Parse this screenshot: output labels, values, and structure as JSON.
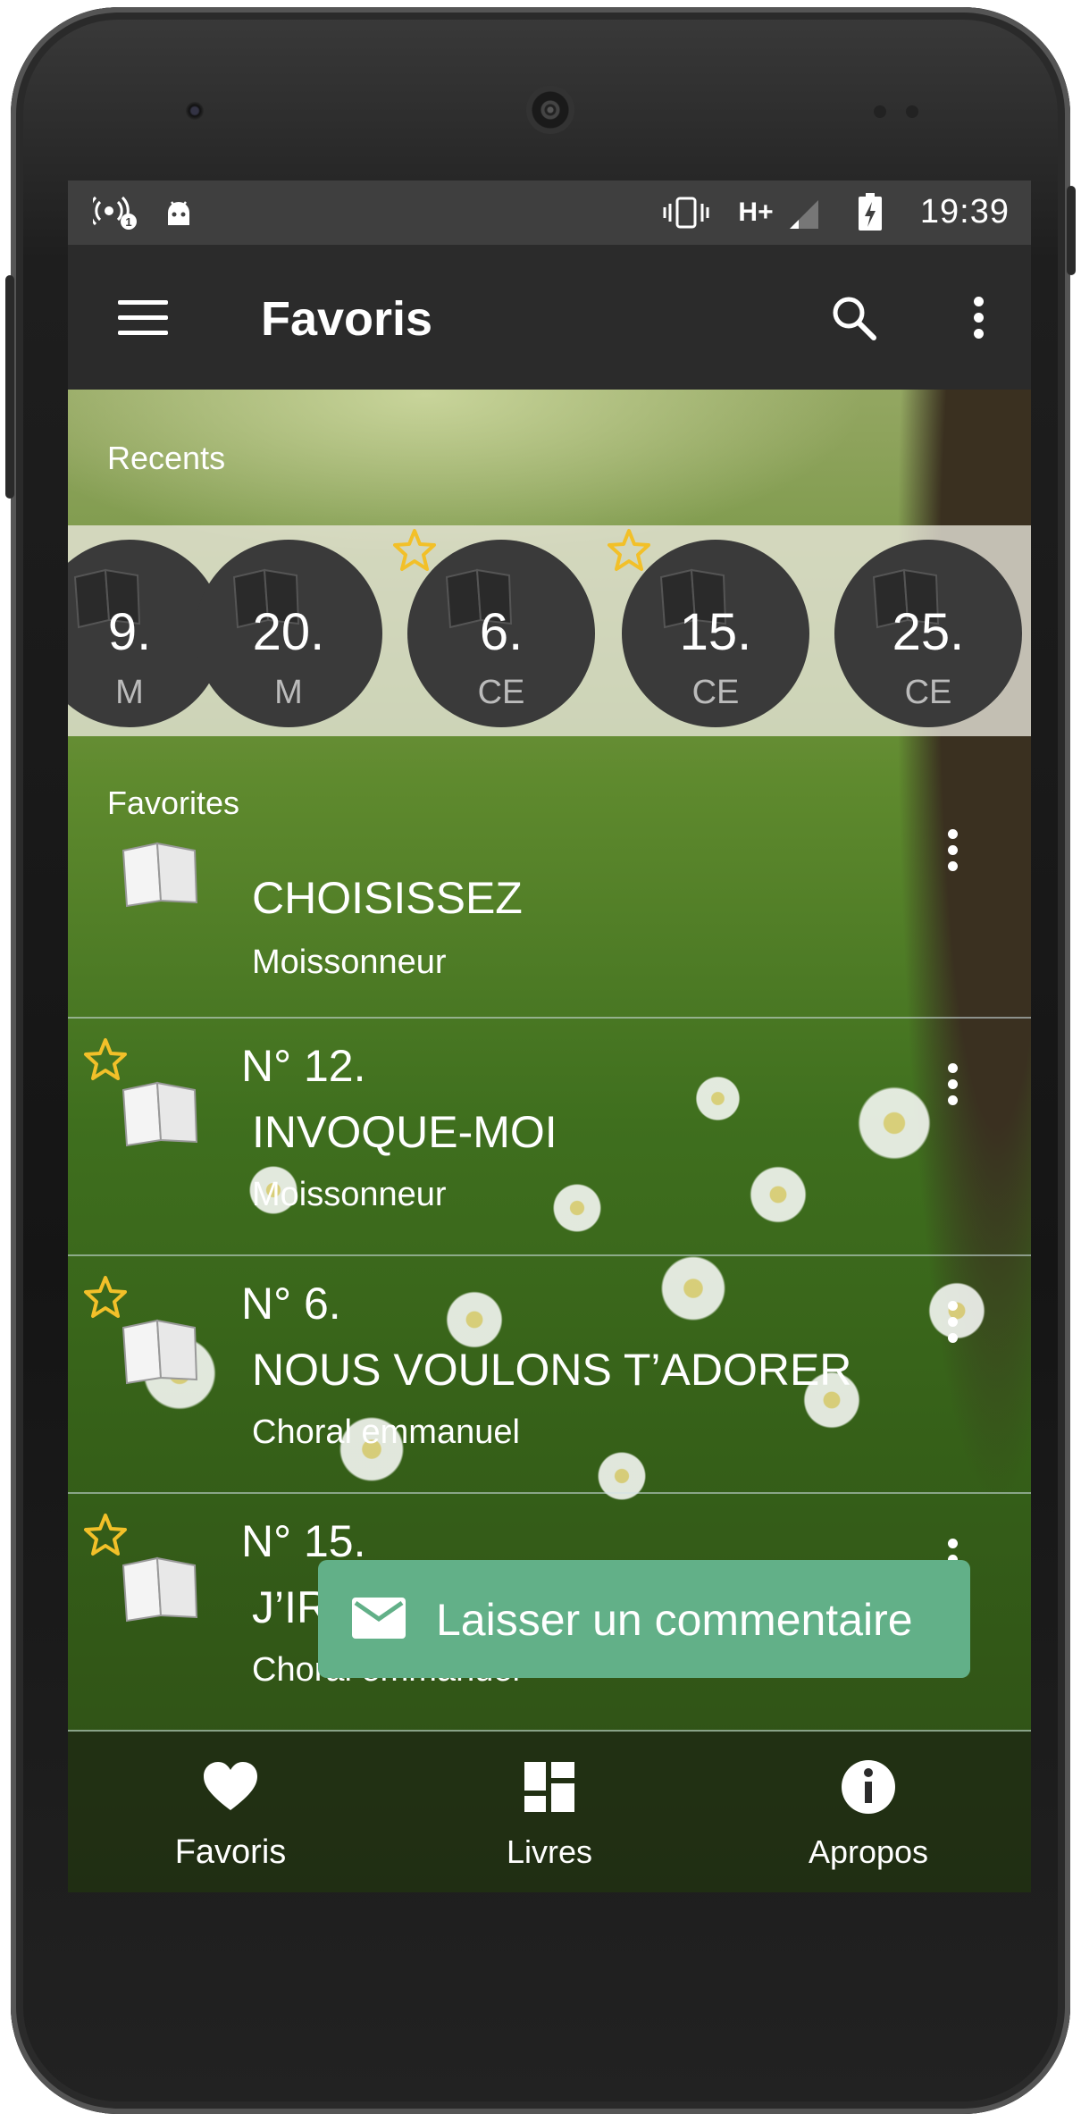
{
  "status_bar": {
    "time": "19:39",
    "network": "H+"
  },
  "app_bar": {
    "title": "Favoris"
  },
  "recents": {
    "label": "Recents",
    "items": [
      {
        "number": "9.",
        "sub": "M",
        "starred": false
      },
      {
        "number": "20.",
        "sub": "M",
        "starred": false
      },
      {
        "number": "6.",
        "sub": "CE",
        "starred": true
      },
      {
        "number": "15.",
        "sub": "CE",
        "starred": true
      },
      {
        "number": "25.",
        "sub": "CE",
        "starred": false
      }
    ]
  },
  "favorites": {
    "label": "Favorites",
    "items": [
      {
        "number": "",
        "title": "CHOISISSEZ",
        "subtitle": "Moissonneur",
        "starred": false
      },
      {
        "number": "N° 12.",
        "title": "INVOQUE-MOI",
        "subtitle": "Moissonneur",
        "starred": true
      },
      {
        "number": "N° 6.",
        "title": "NOUS VOULONS T’ADORER",
        "subtitle": "Choral emmanuel",
        "starred": true
      },
      {
        "number": "N° 15.",
        "title": "J’IR",
        "subtitle": "Choral emmanuel",
        "starred": true
      }
    ]
  },
  "snackbar": {
    "label": "Laisser un commentaire"
  },
  "bottom_nav": {
    "items": [
      {
        "label": "Favoris",
        "icon": "heart-icon"
      },
      {
        "label": "Livres",
        "icon": "dashboard-icon"
      },
      {
        "label": "Apropos",
        "icon": "info-icon"
      }
    ]
  },
  "colors": {
    "app_bar": "#2b2b2b",
    "status_bar": "#3f3f3f",
    "snackbar": "#62b088",
    "star": "#f2c029"
  }
}
